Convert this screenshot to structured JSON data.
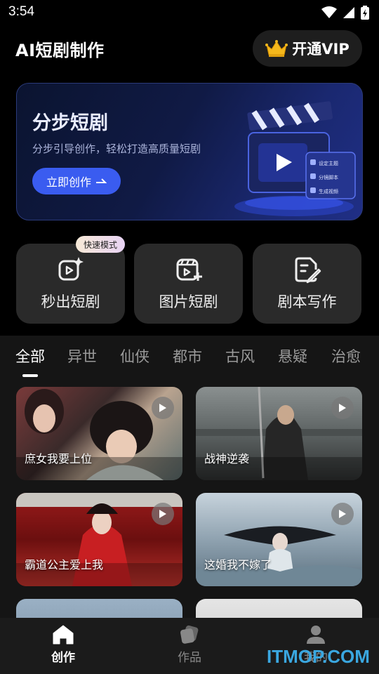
{
  "status_bar": {
    "time": "3:54"
  },
  "header": {
    "title": "AI短剧制作",
    "vip_label": "开通VIP"
  },
  "banner": {
    "title": "分步短剧",
    "subtitle": "分步引导创作，轻松打造高质量短剧",
    "button_label": "立即创作",
    "art_steps": [
      "设定主题",
      "分镜脚本",
      "生成视频"
    ]
  },
  "tools": {
    "badge": "快速模式",
    "items": [
      {
        "label": "秒出短剧",
        "icon": "sparkle-video-icon"
      },
      {
        "label": "图片短剧",
        "icon": "image-video-icon"
      },
      {
        "label": "剧本写作",
        "icon": "script-edit-icon"
      }
    ]
  },
  "tabs": [
    "全部",
    "异世",
    "仙侠",
    "都市",
    "古风",
    "悬疑",
    "治愈"
  ],
  "active_tab": "全部",
  "dramas": [
    {
      "title": "庶女我要上位"
    },
    {
      "title": "战神逆袭"
    },
    {
      "title": "霸道公主爱上我"
    },
    {
      "title": "这婚我不嫁了"
    }
  ],
  "bottom_nav": [
    {
      "label": "创作",
      "icon": "home-icon",
      "active": true
    },
    {
      "label": "作品",
      "icon": "works-icon",
      "active": false
    },
    {
      "label": "我的",
      "icon": "profile-icon",
      "active": false
    }
  ],
  "watermark": "ITMOP.COM",
  "colors": {
    "accent": "#3a5cf0",
    "background": "#000000",
    "card": "#2a2a2a"
  }
}
